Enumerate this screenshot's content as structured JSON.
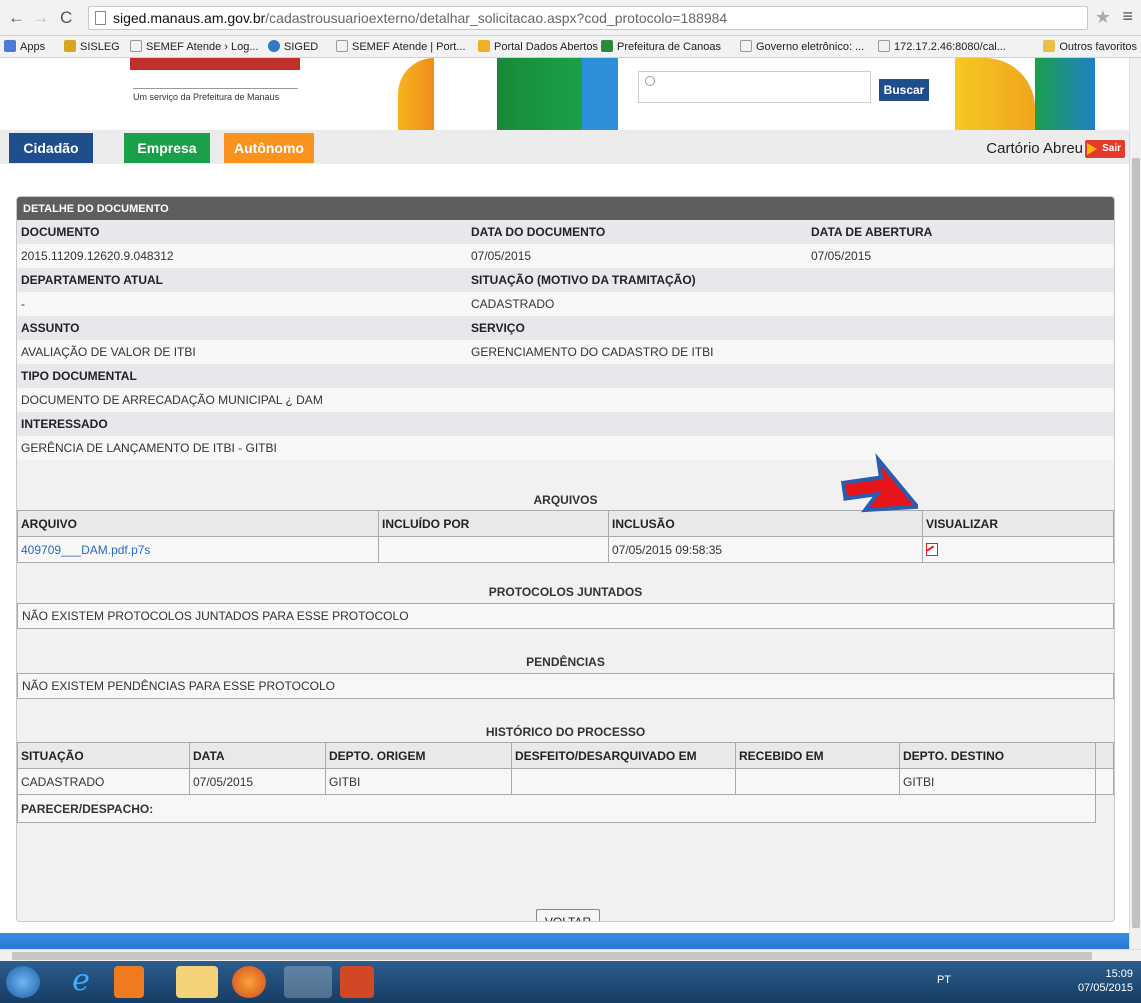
{
  "browser": {
    "url_host": "siged.manaus.am.gov.br",
    "url_path": "/cadastrousuarioexterno/detalhar_solicitacao.aspx?cod_protocolo=188984",
    "bookmarks": [
      "Apps",
      "SISLEG",
      "SEMEF Atende › Log...",
      "SIGED",
      "SEMEF Atende | Port...",
      "Portal Dados Abertos",
      "Prefeitura de Canoas",
      "Governo eletrônico: ...",
      "172.17.2.46:8080/cal..."
    ],
    "outros": "Outros favoritos"
  },
  "header": {
    "logo_sub": "Um serviço da Prefeitura de Manaus",
    "search_button": "Buscar"
  },
  "tabs": {
    "cidadao": "Cidadão",
    "empresa": "Empresa",
    "autonomo": "Autônomo",
    "user": "Cartório Abreu",
    "sair": "Sair"
  },
  "detail": {
    "title": "DETALHE DO DOCUMENTO",
    "lbl_documento": "DOCUMENTO",
    "lbl_data_doc": "DATA DO DOCUMENTO",
    "lbl_data_abertura": "DATA DE ABERTURA",
    "documento": "2015.11209.12620.9.048312",
    "data_doc": "07/05/2015",
    "data_abertura": "07/05/2015",
    "lbl_departamento": "DEPARTAMENTO ATUAL",
    "lbl_situacao": "SITUAÇÃO (MOTIVO DA TRAMITAÇÃO)",
    "departamento": "-",
    "situacao": "CADASTRADO",
    "lbl_assunto": "ASSUNTO",
    "lbl_servico": "SERVIÇO",
    "assunto": "AVALIAÇÃO DE VALOR DE ITBI",
    "servico": "GERENCIAMENTO DO CADASTRO DE ITBI",
    "lbl_tipo": "TIPO DOCUMENTAL",
    "tipo": "DOCUMENTO DE ARRECADAÇÃO MUNICIPAL ¿ DAM",
    "lbl_interessado": "INTERESSADO",
    "interessado": "GERÊNCIA DE LANÇAMENTO DE ITBI - GITBI"
  },
  "arquivos": {
    "title": "ARQUIVOS",
    "headers": [
      "ARQUIVO",
      "INCLUÍDO POR",
      "INCLUSÃO",
      "VISUALIZAR"
    ],
    "file": "409709___DAM.pdf.p7s",
    "incluido_por": "",
    "inclusao": "07/05/2015 09:58:35"
  },
  "protocolos": {
    "title": "PROTOCOLOS JUNTADOS",
    "msg": "NÃO EXISTEM PROTOCOLOS JUNTADOS PARA ESSE PROTOCOLO"
  },
  "pendencias": {
    "title": "PENDÊNCIAS",
    "msg": "NÃO EXISTEM PENDÊNCIAS PARA ESSE PROTOCOLO"
  },
  "historico": {
    "title": "HISTÓRICO DO PROCESSO",
    "headers": [
      "SITUAÇÃO",
      "DATA",
      "DEPTO. ORIGEM",
      "DESFEITO/DESARQUIVADO EM",
      "RECEBIDO EM",
      "DEPTO. DESTINO"
    ],
    "row": [
      "CADASTRADO",
      "07/05/2015",
      "GITBI",
      "",
      "",
      "GITBI"
    ],
    "parecer": "PARECER/DESPACHO:"
  },
  "voltar": "VOLTAR",
  "taskbar": {
    "lang": "PT",
    "time": "15:09",
    "date": "07/05/2015"
  },
  "colors": {
    "cidadao": "#1e4f8c",
    "empresa": "#1aa04a",
    "autonomo": "#f7931e",
    "arrow": "#e8141b",
    "arrow_outline": "#2a5db0"
  }
}
